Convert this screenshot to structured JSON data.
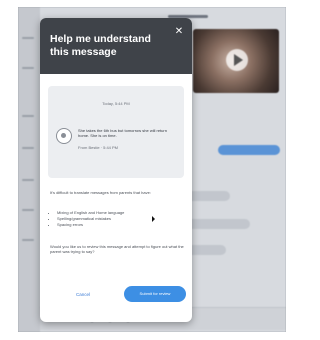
{
  "dialog": {
    "title": "Help me understand this message",
    "close_icon": "close-icon",
    "preview": {
      "time": "Today, 5:44 PM",
      "message": "She takes the 6th bus but tomorrow she will return home. She is on time.",
      "meta": "From Bestie · 5:44 PM",
      "icon": "message-icon"
    },
    "explanation": "It's difficult to translate messages from parents that have:",
    "reasons": [
      "Mixing of English and Home language",
      "Spelling/grammatical mistakes",
      "Spacing errors"
    ],
    "question": "Would you like us to review this message and attempt to figure out what the parent was trying to say?",
    "cancel_label": "Cancel",
    "submit_label": "Submit for review"
  },
  "colors": {
    "dialog_header": "#3f4349",
    "accent": "#3d8fe4",
    "outgoing_bubble": "#5a93d6"
  }
}
